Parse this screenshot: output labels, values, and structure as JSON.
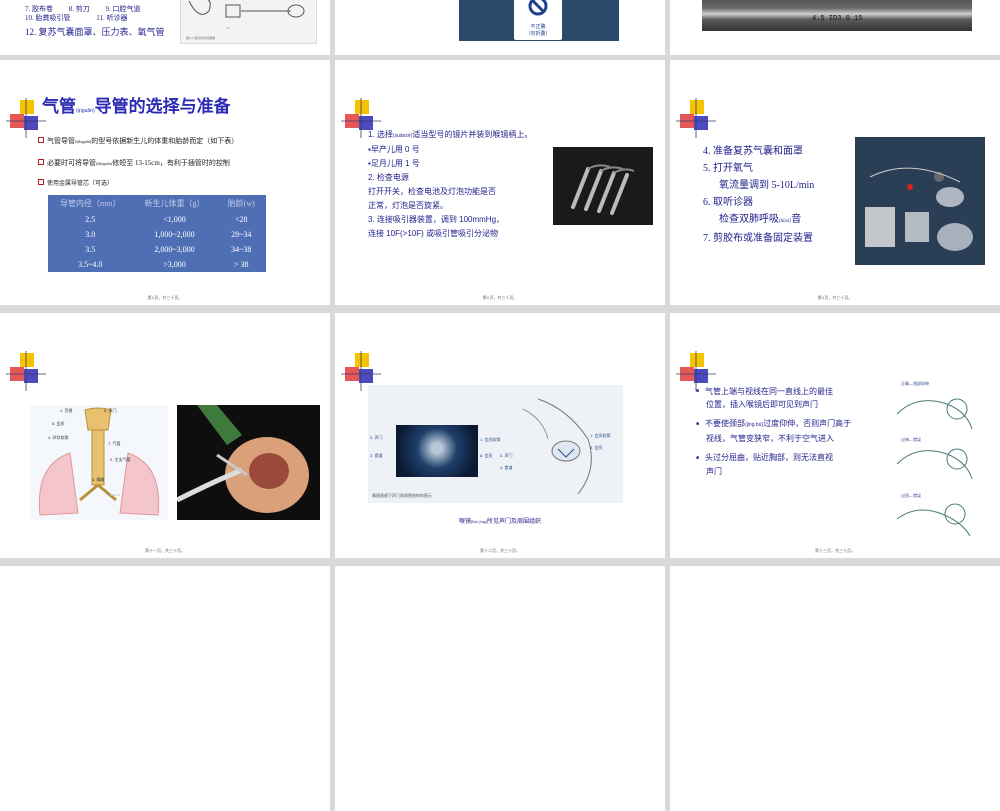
{
  "slides": {
    "s1": {
      "lines": [
        "7. 胶布卷",
        "8. 剪刀",
        "9. 口腔气道",
        "10. 胎粪吸引管",
        "11. 听诊器",
        "12. 复苏气囊面罩、压力表、氧气管"
      ],
      "fig_caption": "图9-1 插管的常用器械"
    },
    "s2": {
      "label_line1": "不正确",
      "label_line2": "（勿折叠）"
    },
    "s3": {
      "tube_text": "4.5   ID3.0   15"
    },
    "s4": {
      "title_main1": "气管",
      "title_ruby": "(qìguǎn)",
      "title_main2": "导管的选择与准备",
      "b1_pre": "气管导管",
      "b1_ruby": "(dǎoguǎn)",
      "b1_post": "的型号依据新生儿的体重和胎龄而定（如下表）",
      "b2_pre": "必要时可将导管",
      "b2_ruby": "(dǎoguǎn)",
      "b2_post": "修短至 13-15cm，有利于插管时的控制",
      "b3": "使用金属导管芯（可选）",
      "table_headers": [
        "导管内径（mm）",
        "新生儿体重（g）",
        "胎龄(w)"
      ],
      "table_rows": [
        [
          "2.5",
          "<1,000",
          "<28"
        ],
        [
          "3.0",
          "1,000~2,000",
          "28~34"
        ],
        [
          "3.5",
          "2,000~3,000",
          "34~38"
        ],
        [
          "3.5~4.0",
          ">3,000",
          "> 38"
        ]
      ],
      "footer": "第X页，共三十页。"
    },
    "s5": {
      "l1_pre": "1. 选择",
      "l1_ruby": "(xuǎnzé)",
      "l1_post": "适当型号的镜片并装到喉镜柄上。",
      "l2": "▪早产儿用 0 号",
      "l3": "▪足月儿用 1 号",
      "l4": "2. 检查电源",
      "l5": "打开开关，检查电池及灯泡功能是否",
      "l6": "正常，灯泡是否旋紧。",
      "l7": "3. 连接吸引器装置，调到 100mmHg，",
      "l8": "连接 10F(>10F) 或吸引管吸引分泌物",
      "footer": "第X页，共三十页。"
    },
    "s6": {
      "l1": "4. 准备复苏气囊和面罩",
      "l2": "5. 打开氧气",
      "l3": "氧流量调到 5-10L/min",
      "l4": "6. 取听诊器",
      "l5_pre": "检查双肺呼吸",
      "l5_ruby": "(hūxī)",
      "l5_post": "音",
      "l6": "7. 剪胶布或准备固定装置",
      "footer": "第X页，共三十页。"
    },
    "s7": {
      "labels": [
        "1. 舌根",
        "5. 声门",
        "8. 会厌",
        "4. 环状软骨",
        "7. 气管",
        "2. 主支气管",
        "3. 隆嵴"
      ],
      "footer": "第十一页，共三十页。"
    },
    "s8": {
      "left_labels": [
        "5. 声门",
        "3. 食道",
        "1. 会厌软骨",
        "8. 会厌"
      ],
      "right_labels": [
        "1. 会厌软骨",
        "8. 会厌",
        "5. 声门",
        "3. 食道"
      ],
      "panel_caption": "喉镜直视下声门和周围结构的图示",
      "caption_pre": "喉镜",
      "caption_ruby": "(hóu jìng)",
      "caption_post": "所见声门及周围组织",
      "footer": "第十二页，共三十页。"
    },
    "s9": {
      "b1a": "气管上端与视线在同一直线上的最佳",
      "b1b": "位置，插入喉镜后即可见到声门",
      "b2a_pre": "不要使颈部",
      "b2a_ruby": "(jǐng bù)",
      "b2a_post": "过度仰伸，否则声门高于",
      "b2b": "视线，气管变狭窄，不利于空气进入",
      "b3a": "头过分屈曲，贴近胸部，则无法直视",
      "b3b": "声门",
      "fig_labels": [
        "正确—颈部仰伸",
        "过伸—错误",
        "过屈—错误"
      ],
      "footer": "第十三页，共三十页。"
    }
  },
  "colors": {
    "title_blue": "#2b2bb3",
    "text_blue": "#1f1f8c",
    "table_bg": "#4f6fb5"
  }
}
